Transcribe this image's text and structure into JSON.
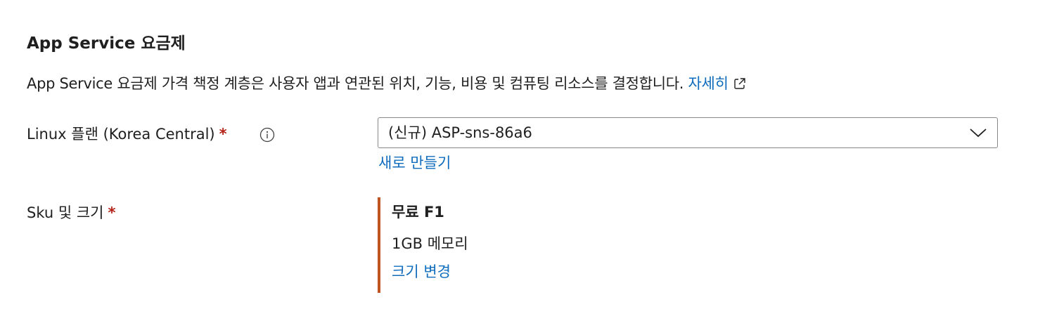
{
  "section": {
    "title": "App Service 요금제",
    "description": "App Service 요금제 가격 책정 계층은 사용자 앱과 연관된 위치, 기능, 비용 및 컴퓨팅 리소스를 결정합니다.",
    "learn_more_label": "자세히",
    "external_link_icon": "external-link-icon"
  },
  "linux_plan": {
    "label": "Linux 플랜 (Korea Central)",
    "required_mark": "*",
    "info_icon": "info-icon",
    "selected_value": "(신규) ASP-sns-86a6",
    "create_new_label": "새로 만들기"
  },
  "sku": {
    "label": "Sku 및 크기",
    "required_mark": "*",
    "name": "무료 F1",
    "memory": "1GB 메모리",
    "change_size_label": "크기 변경",
    "accent_color": "#c05521"
  },
  "colors": {
    "link": "#0f6cbd",
    "required": "#b42318",
    "text": "#1f1f1f"
  }
}
